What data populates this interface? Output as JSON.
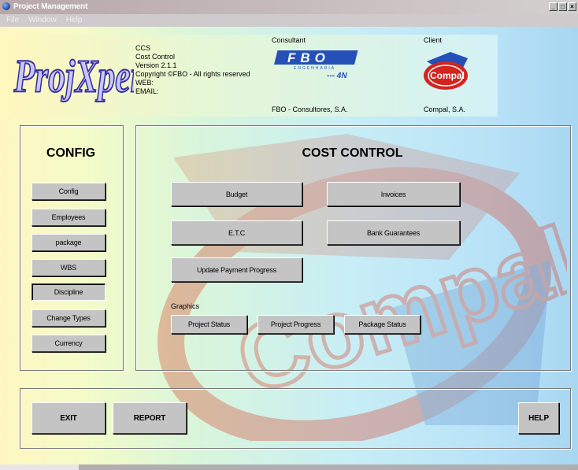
{
  "window": {
    "title": "Project Management",
    "controls": [
      "_",
      "□",
      "×"
    ]
  },
  "menu": [
    "File",
    "Window",
    "Help"
  ],
  "header": {
    "logo_text": "ProjXpert",
    "info_lines": [
      "CCS",
      "Cost Control",
      "Version 2.1.1",
      "Copyright ©FBO - All rights reserved",
      "WEB:",
      "EMAIL:"
    ],
    "consultant_label": "Consultant",
    "consultant_logo_text": "FBO",
    "consultant_tagline": "ENGENHARIA",
    "consultant_sub": "--- 4N",
    "consultant_name": "FBO - Consultores, S.A.",
    "client_label": "Client",
    "client_logo_text": "Compal",
    "client_name": "Compal, S.A."
  },
  "config": {
    "title": "CONFIG",
    "buttons": [
      "Config",
      "Employees",
      "package",
      "WBS",
      "Discipline",
      "Change Types",
      "Currency"
    ]
  },
  "cost": {
    "title": "COST CONTROL",
    "budget": "Budget",
    "invoices": "Invoices",
    "etc": "E.T.C",
    "bank": "Bank Guarantees",
    "update": "Update Payment Progress",
    "graphics_label": "Graphics",
    "project_status": "Project Status",
    "project_progress": "Project Progress",
    "package_status": "Package Status"
  },
  "footer": {
    "exit": "EXIT",
    "report": "REPORT",
    "help": "HELP"
  },
  "watermark_text": "Compal",
  "colors": {
    "watermark_red": "#d9472f",
    "watermark_blue": "#2a63b5",
    "fbo_blue": "#2450b8",
    "compal_red": "#d3241e"
  }
}
